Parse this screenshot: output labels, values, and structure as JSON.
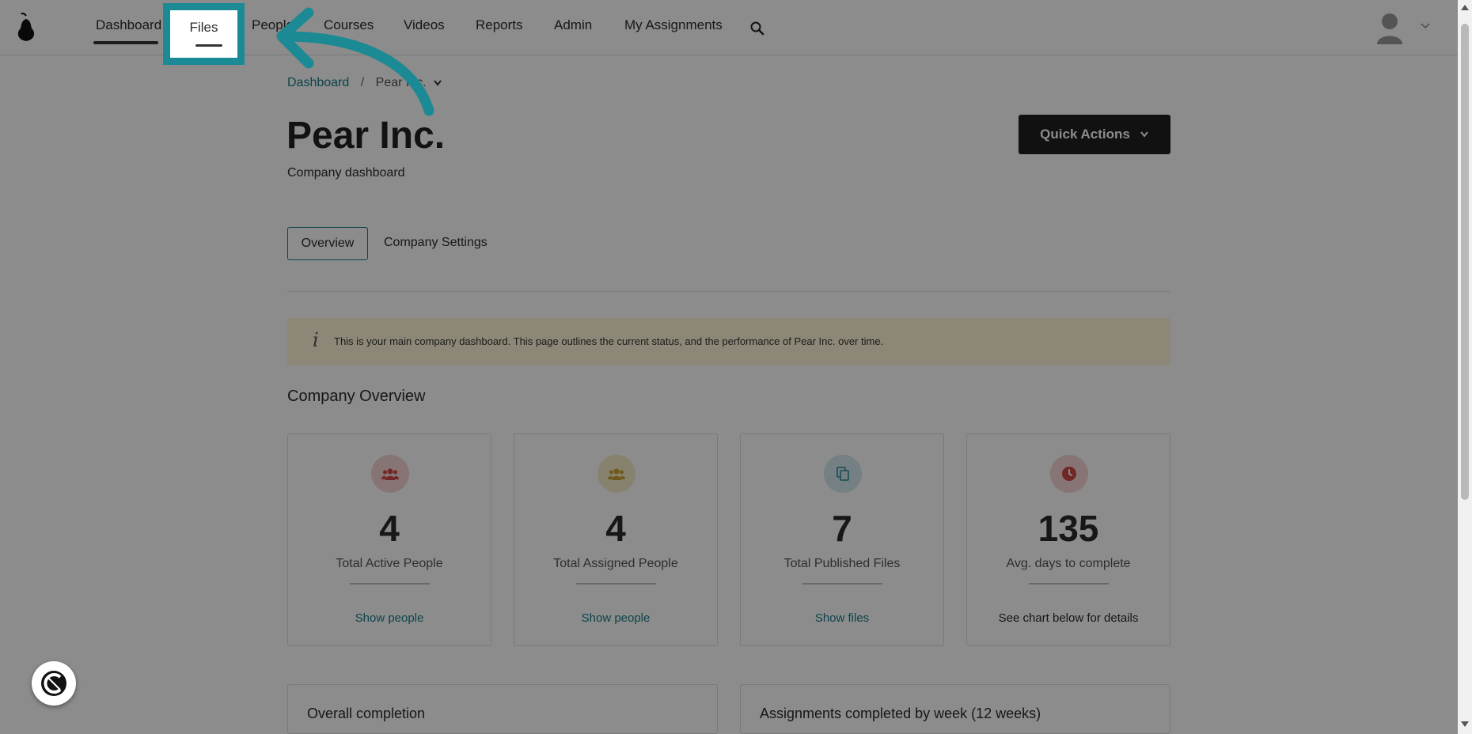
{
  "nav": {
    "items": [
      "Dashboard",
      "Files",
      "People",
      "Courses",
      "Videos",
      "Reports",
      "Admin",
      "My Assignments"
    ],
    "search_icon": "search-icon",
    "avatar_icon": "user-avatar-icon"
  },
  "breadcrumb": {
    "root": "Dashboard",
    "separator": "/",
    "current": "Pear Inc."
  },
  "header": {
    "title": "Pear Inc.",
    "subtitle": "Company dashboard",
    "quick_actions": "Quick Actions"
  },
  "tabs": [
    "Overview",
    "Company Settings"
  ],
  "info_banner": "This is your main company dashboard. This page outlines the current status, and the performance of Pear Inc. over time.",
  "overview": {
    "title": "Company Overview",
    "cards": [
      {
        "value": "4",
        "label": "Total Active People",
        "link": "Show people",
        "icon": "people-icon",
        "color": "#f6d5d5"
      },
      {
        "value": "4",
        "label": "Total Assigned People",
        "link": "Show people",
        "icon": "people-icon",
        "color": "#f6edc9"
      },
      {
        "value": "7",
        "label": "Total Published Files",
        "link": "Show files",
        "icon": "files-icon",
        "color": "#d3e9ee"
      },
      {
        "value": "135",
        "label": "Avg. days to complete",
        "note": "See chart below for details",
        "icon": "clock-icon",
        "color": "#f6d5d5"
      }
    ]
  },
  "panels": [
    "Overall completion",
    "Assignments completed by week (12 weeks)"
  ],
  "highlight_color": "#1b8a94"
}
